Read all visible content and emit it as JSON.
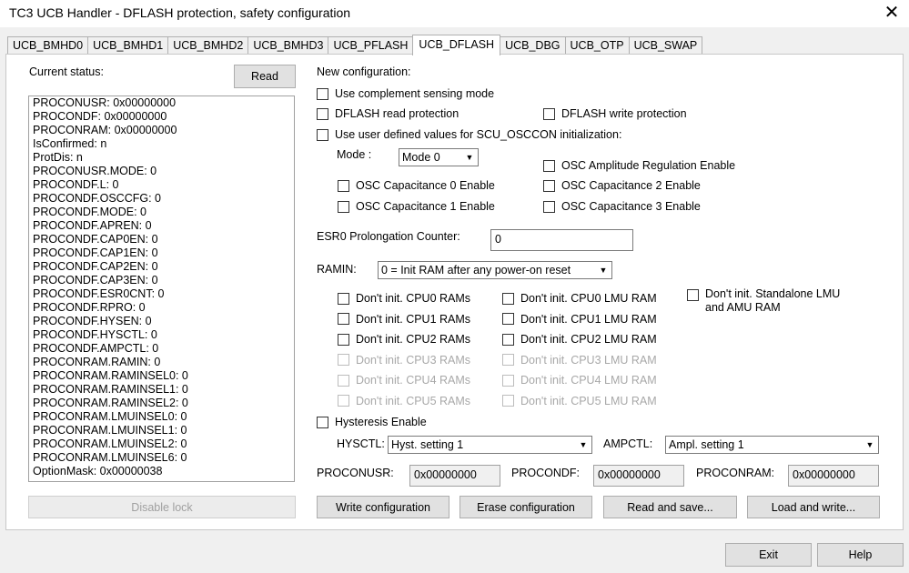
{
  "window": {
    "title": "TC3 UCB Handler - DFLASH protection, safety configuration",
    "close_glyph": "✕"
  },
  "tabs": [
    "UCB_BMHD0",
    "UCB_BMHD1",
    "UCB_BMHD2",
    "UCB_BMHD3",
    "UCB_PFLASH",
    "UCB_DFLASH",
    "UCB_DBG",
    "UCB_OTP",
    "UCB_SWAP"
  ],
  "active_tab": "UCB_DFLASH",
  "status": {
    "label": "Current status:",
    "read_button": "Read",
    "lines": [
      "PROCONUSR: 0x00000000",
      "PROCONDF: 0x00000000",
      "PROCONRAM: 0x00000000",
      "IsConfirmed: n",
      "ProtDis: n",
      "PROCONUSR.MODE: 0",
      "PROCONDF.L: 0",
      "PROCONDF.OSCCFG: 0",
      "PROCONDF.MODE: 0",
      "PROCONDF.APREN: 0",
      "PROCONDF.CAP0EN: 0",
      "PROCONDF.CAP1EN: 0",
      "PROCONDF.CAP2EN: 0",
      "PROCONDF.CAP3EN: 0",
      "PROCONDF.ESR0CNT: 0",
      "PROCONDF.RPRO: 0",
      "PROCONDF.HYSEN: 0",
      "PROCONDF.HYSCTL: 0",
      "PROCONDF.AMPCTL: 0",
      "PROCONRAM.RAMIN: 0",
      "PROCONRAM.RAMINSEL0: 0",
      "PROCONRAM.RAMINSEL1: 0",
      "PROCONRAM.RAMINSEL2: 0",
      "PROCONRAM.LMUINSEL0: 0",
      "PROCONRAM.LMUINSEL1: 0",
      "PROCONRAM.LMUINSEL2: 0",
      "PROCONRAM.LMUINSEL6: 0",
      "OptionMask: 0x00000038"
    ],
    "disable_lock_button": "Disable lock"
  },
  "config": {
    "label": "New configuration:",
    "complement_sensing": "Use complement sensing mode",
    "dflash_read_protection": "DFLASH read protection",
    "dflash_write_protection": "DFLASH write protection",
    "user_defined_osccon": "Use user defined values for SCU_OSCCON initialization:",
    "mode_label": "Mode :",
    "mode_value": "Mode 0",
    "osc_amp_reg": "OSC Amplitude Regulation Enable",
    "osc_cap0": "OSC Capacitance 0 Enable",
    "osc_cap1": "OSC Capacitance 1 Enable",
    "osc_cap2": "OSC Capacitance 2 Enable",
    "osc_cap3": "OSC Capacitance 3 Enable",
    "esr0_label": "ESR0 Prolongation Counter:",
    "esr0_value": "0",
    "ramin_label": "RAMIN:",
    "ramin_value": "0 = Init RAM after any power-on reset",
    "cpu_rams": [
      "Don't init. CPU0 RAMs",
      "Don't init. CPU1 RAMs",
      "Don't init. CPU2 RAMs",
      "Don't init. CPU3 RAMs",
      "Don't init. CPU4 RAMs",
      "Don't init. CPU5 RAMs"
    ],
    "lmu_rams": [
      "Don't init. CPU0 LMU RAM",
      "Don't init. CPU1 LMU RAM",
      "Don't init. CPU2 LMU RAM",
      "Don't init. CPU3 LMU RAM",
      "Don't init. CPU4 LMU RAM",
      "Don't init. CPU5 LMU RAM"
    ],
    "standalone_lmu_line1": "Don't init. Standalone LMU",
    "standalone_lmu_line2": "and AMU RAM",
    "hysteresis_enable": "Hysteresis Enable",
    "hysctl_label": "HYSCTL:",
    "hysctl_value": "Hyst. setting 1",
    "ampctl_label": "AMPCTL:",
    "ampctl_value": "Ampl. setting 1",
    "proconusr_label": "PROCONUSR:",
    "proconusr_value": "0x00000000",
    "procondf_label": "PROCONDF:",
    "procondf_value": "0x00000000",
    "proconram_label": "PROCONRAM:",
    "proconram_value": "0x00000000",
    "write_button": "Write configuration",
    "erase_button": "Erase configuration",
    "read_save_button": "Read and save...",
    "load_write_button": "Load and write..."
  },
  "footer": {
    "exit_button": "Exit",
    "help_button": "Help"
  },
  "icons": {
    "dropdown": "chevron-down-icon"
  }
}
